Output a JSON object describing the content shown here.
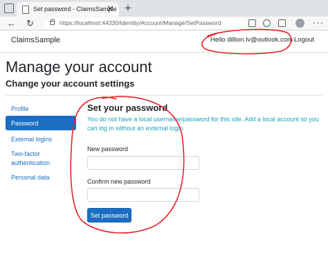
{
  "browser": {
    "tab_title": "Set password - ClaimsSample",
    "tab_close": "✕",
    "new_tab": "+",
    "url": "https://localhost:44330/Identity/Account/Manage/SetPassword",
    "icons": {
      "back": "←",
      "refresh": "↻",
      "more": "···"
    }
  },
  "navbar": {
    "brand": "ClaimsSample",
    "hello": "Hello dillion.lv@outlook.com",
    "logout": "Logout"
  },
  "page": {
    "title": "Manage your account",
    "subtitle": "Change your account settings"
  },
  "sidenav": {
    "items": [
      {
        "label": "Profile"
      },
      {
        "label": "Password"
      },
      {
        "label": "External logins"
      },
      {
        "label": "Two-factor authentication"
      },
      {
        "label": "Personal data"
      }
    ]
  },
  "form": {
    "heading": "Set your password",
    "info": "You do not have a local username/password for this site. Add a local account so you can log in without an external login.",
    "new_password_label": "New password",
    "new_password_value": "",
    "confirm_password_label": "Confirm new password",
    "confirm_password_value": "",
    "submit_label": "Set password"
  },
  "colors": {
    "primary": "#1b6ec2",
    "info_text": "#17a2b8",
    "annotation": "#e8202a"
  }
}
